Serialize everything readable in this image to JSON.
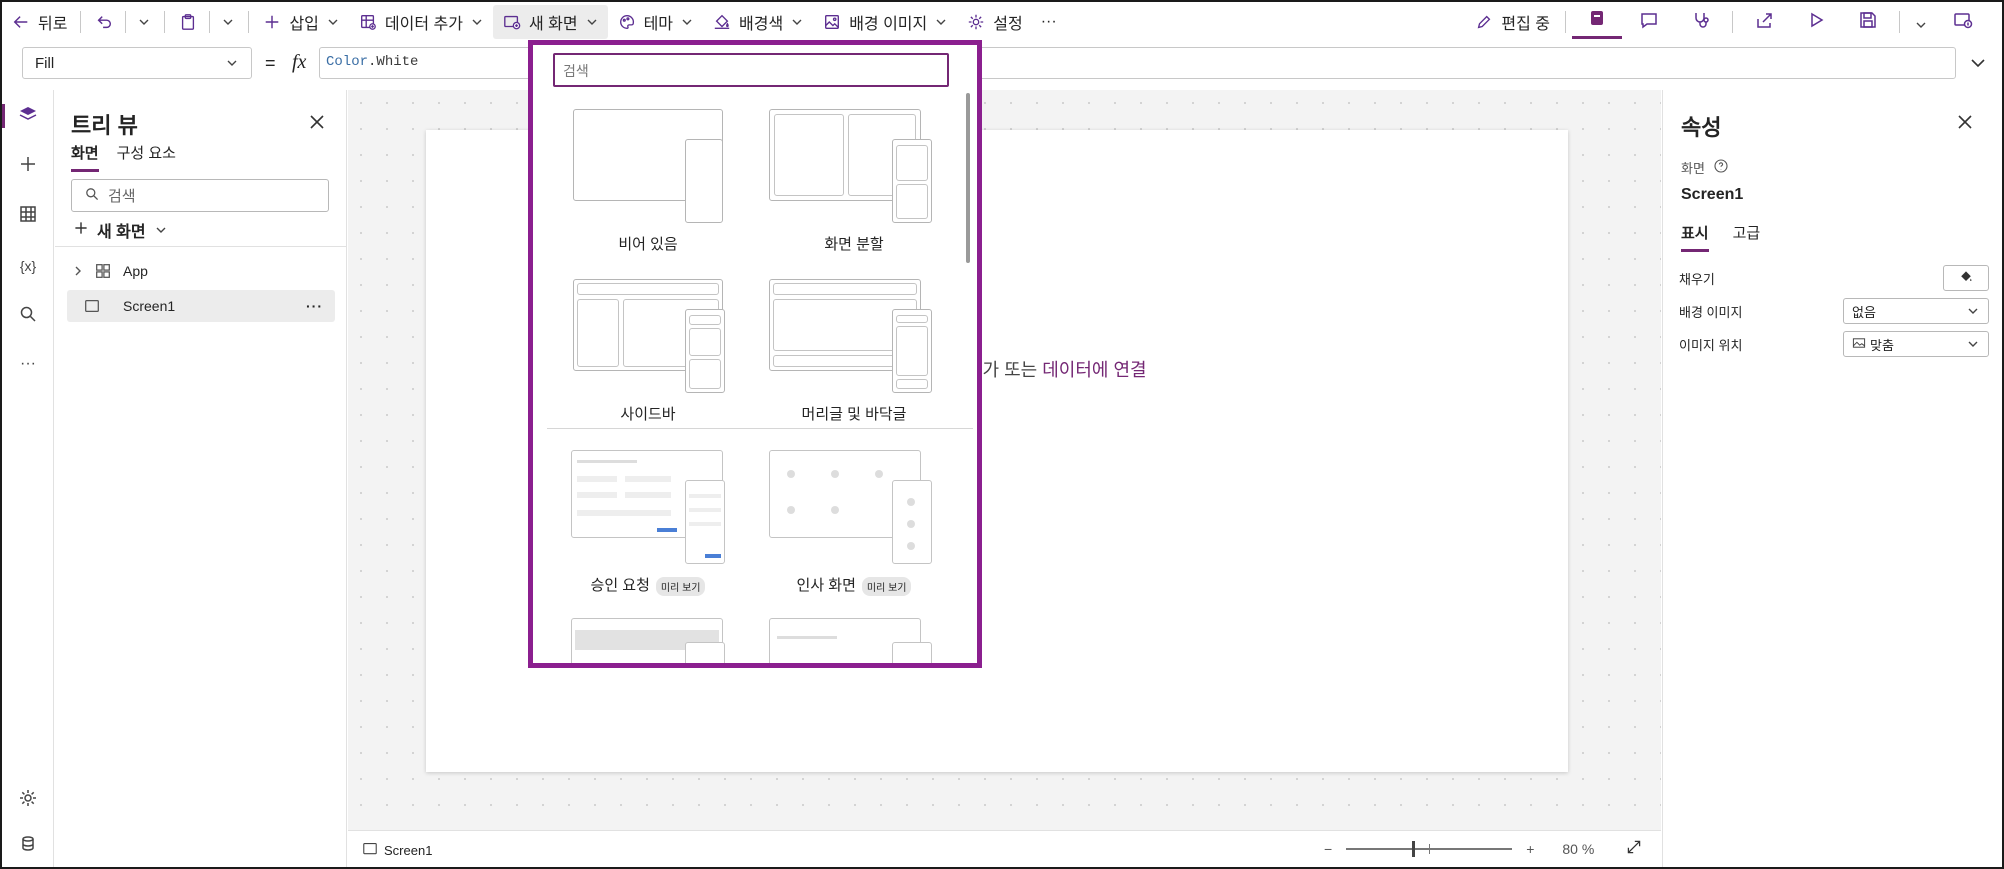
{
  "toolbar": {
    "back": "뒤로",
    "insert": "삽입",
    "add_data": "데이터 추가",
    "new_screen": "새 화면",
    "theme": "테마",
    "background_color": "배경색",
    "background_image": "배경 이미지",
    "settings": "설정",
    "more": "···",
    "editing": "편집 중"
  },
  "formula": {
    "property": "Fill",
    "equals": "=",
    "fx": "fx",
    "value_prefix": "Color",
    "value_suffix": ".White"
  },
  "tree": {
    "title": "트리 뷰",
    "tabs": [
      "화면",
      "구성 요소"
    ],
    "search_placeholder": "검색",
    "new_screen": "새 화면",
    "items": [
      {
        "label": "App"
      },
      {
        "label": "Screen1"
      }
    ]
  },
  "canvas": {
    "hint_prefix": "추가 또는 ",
    "hint_link": "데이터에 연결"
  },
  "status": {
    "screen": "Screen1",
    "zoom_minus": "−",
    "zoom_plus": "+",
    "zoom": "80 %",
    "zoom_fraction": 0.4
  },
  "flyout": {
    "search_placeholder": "검색",
    "layouts": [
      "비어 있음",
      "화면 분할",
      "사이드바",
      "머리글 및 바닥글"
    ],
    "templates": [
      {
        "label": "승인 요청",
        "badge": "미리 보기"
      },
      {
        "label": "인사 화면",
        "badge": "미리 보기"
      }
    ]
  },
  "props": {
    "title": "속성",
    "type": "화면",
    "name": "Screen1",
    "tabs": [
      "표시",
      "고급"
    ],
    "rows": [
      {
        "label": "채우기"
      },
      {
        "label": "배경 이미지",
        "value": "없음"
      },
      {
        "label": "이미지 위치",
        "value": "맞춤"
      }
    ]
  },
  "colors": {
    "accent": "#742774",
    "flyout_border": "#8b1f8f",
    "canvas_bg": "#f3f3f3"
  }
}
